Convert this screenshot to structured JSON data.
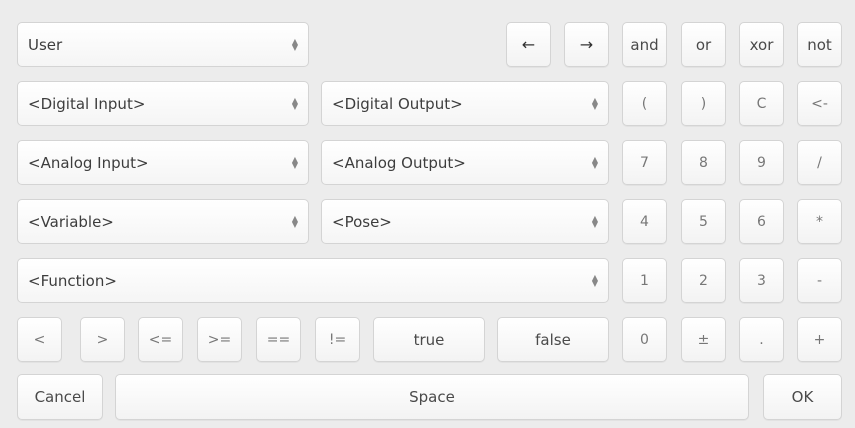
{
  "selects": {
    "user": "User",
    "digital_input": "<Digital Input>",
    "digital_output": "<Digital Output>",
    "analog_input": "<Analog Input>",
    "analog_output": "<Analog Output>",
    "variable": "<Variable>",
    "pose": "<Pose>",
    "function": "<Function>"
  },
  "icons": {
    "select_arrows": "select-arrows-icon",
    "left_arrow": "arrow-left-icon",
    "right_arrow": "arrow-right-icon"
  },
  "keys": {
    "left": "←",
    "right": "→",
    "and": "and",
    "or": "or",
    "xor": "xor",
    "not": "not",
    "open_paren": "(",
    "close_paren": ")",
    "clear": "C",
    "backspace": "<-",
    "d7": "7",
    "d8": "8",
    "d9": "9",
    "divide": "/",
    "d4": "4",
    "d5": "5",
    "d6": "6",
    "multiply": "*",
    "d1": "1",
    "d2": "2",
    "d3": "3",
    "minus": "-",
    "lt": "<",
    "gt": ">",
    "lte": "<=",
    "gte": ">=",
    "eq": "==",
    "neq": "!=",
    "true": "true",
    "false": "false",
    "d0": "0",
    "plusminus": "±",
    "dot": ".",
    "plus": "+",
    "cancel": "Cancel",
    "space": "Space",
    "ok": "OK"
  }
}
